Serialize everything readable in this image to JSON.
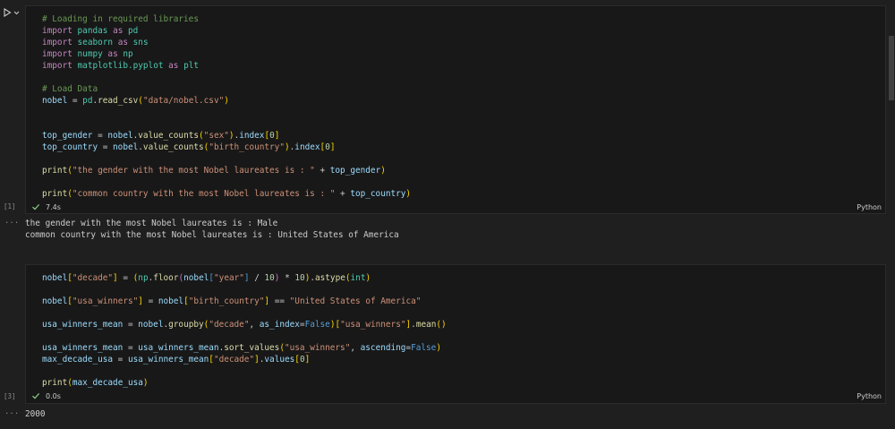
{
  "cells": [
    {
      "exec_count": "[1]",
      "time": "7.4s",
      "language": "Python",
      "lines": [
        "# Loading in required libraries",
        "import pandas as pd",
        "import seaborn as sns",
        "import numpy as np",
        "import matplotlib.pyplot as plt",
        "",
        "# Load Data",
        "nobel = pd.read_csv(\"data/nobel.csv\")",
        "",
        "",
        "top_gender = nobel.value_counts(\"sex\").index[0]",
        "top_country = nobel.value_counts(\"birth_country\").index[0]",
        "",
        "print(\"the gender with the most Nobel laureates is : \" + top_gender)",
        "",
        "print(\"common country with the most Nobel laureates is : \" + top_country)"
      ],
      "output": [
        "the gender with the most Nobel laureates is : Male",
        "common country with the most Nobel laureates is : United States of America"
      ]
    },
    {
      "exec_count": "[3]",
      "time": "0.0s",
      "language": "Python",
      "lines": [
        "nobel[\"decade\"] = (np.floor(nobel[\"year\"] / 10) * 10).astype(int)",
        "",
        "nobel[\"usa_winners\"] = nobel[\"birth_country\"] == \"United States of America\"",
        "",
        "usa_winners_mean = nobel.groupby(\"decade\", as_index=False)[\"usa_winners\"].mean()",
        "",
        "usa_winners_mean = usa_winners_mean.sort_values(\"usa_winners\", ascending=False)",
        "max_decade_usa = usa_winners_mean[\"decade\"].values[0]",
        "",
        "print(max_decade_usa)"
      ],
      "output": [
        "2000"
      ]
    }
  ],
  "output_dots": "...",
  "icons": {
    "run": "play-icon",
    "expand": "chevron-down-icon",
    "success": "check-icon"
  },
  "colors": {
    "background": "#1f1f1f",
    "cell": "#181818",
    "comment": "#6a9955",
    "keyword": "#c586c0",
    "string": "#ce9178",
    "function": "#dcdcaa",
    "variable": "#9cdcfe",
    "success": "#89d185"
  }
}
